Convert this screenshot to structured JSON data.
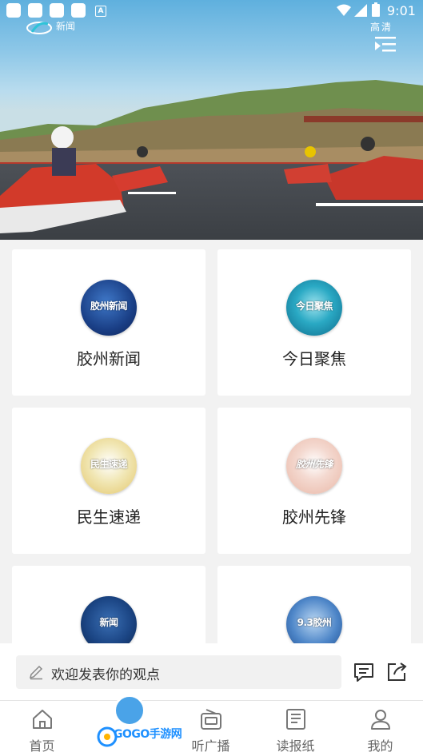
{
  "status_bar": {
    "badge": "A",
    "time": "9:01"
  },
  "video": {
    "logo_text": "新闻",
    "quality_label": "高清"
  },
  "programs": [
    {
      "name": "胶州新闻",
      "thumb_text": "胶州新闻"
    },
    {
      "name": "今日聚焦",
      "thumb_text": "今日聚焦"
    },
    {
      "name": "民生速递",
      "thumb_text": "民生速递"
    },
    {
      "name": "胶州先锋",
      "thumb_text": "胶州先锋"
    },
    {
      "name": "",
      "thumb_text": "新闻"
    },
    {
      "name": "",
      "thumb_text": "9.3胶州"
    }
  ],
  "comment": {
    "placeholder": "欢迎发表你的观点"
  },
  "bottom_nav": [
    {
      "label": "首页",
      "icon": "home-icon"
    },
    {
      "label": "",
      "icon": "tv-icon"
    },
    {
      "label": "听广播",
      "icon": "radio-icon"
    },
    {
      "label": "读报纸",
      "icon": "newspaper-icon"
    },
    {
      "label": "我的",
      "icon": "user-icon"
    }
  ],
  "watermark": {
    "text": "GOGO手游网"
  },
  "colors": {
    "accent": "#4aa3e8",
    "card_bg": "#ffffff",
    "page_bg": "#f2f2f2"
  }
}
